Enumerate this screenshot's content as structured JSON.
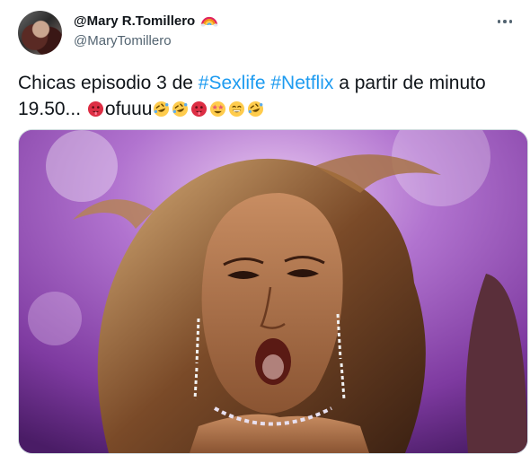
{
  "author": {
    "display_name": "@Mary R.Tomillero",
    "handle": "@MaryTomillero",
    "name_emoji": "rainbow-icon"
  },
  "tweet": {
    "text_part1": "Chicas episodio 3 de ",
    "hashtag1": "#Sexlife",
    "hashtag2": "#Netflix",
    "text_part2": " a partir de minuto 19.50... ",
    "text_part3": "ofuuu",
    "emojis_before": [
      "hot-face-icon"
    ],
    "emojis_after": [
      "rofl-icon",
      "rofl-icon",
      "hot-face-icon",
      "star-struck-icon",
      "grin-squint-icon",
      "rofl-icon"
    ]
  },
  "media": {
    "type": "gif",
    "description_icon": "performer-shocked-image"
  },
  "colors": {
    "hashtag": "#1d9bf0",
    "secondary_text": "#536471",
    "border": "#cfd9de"
  }
}
